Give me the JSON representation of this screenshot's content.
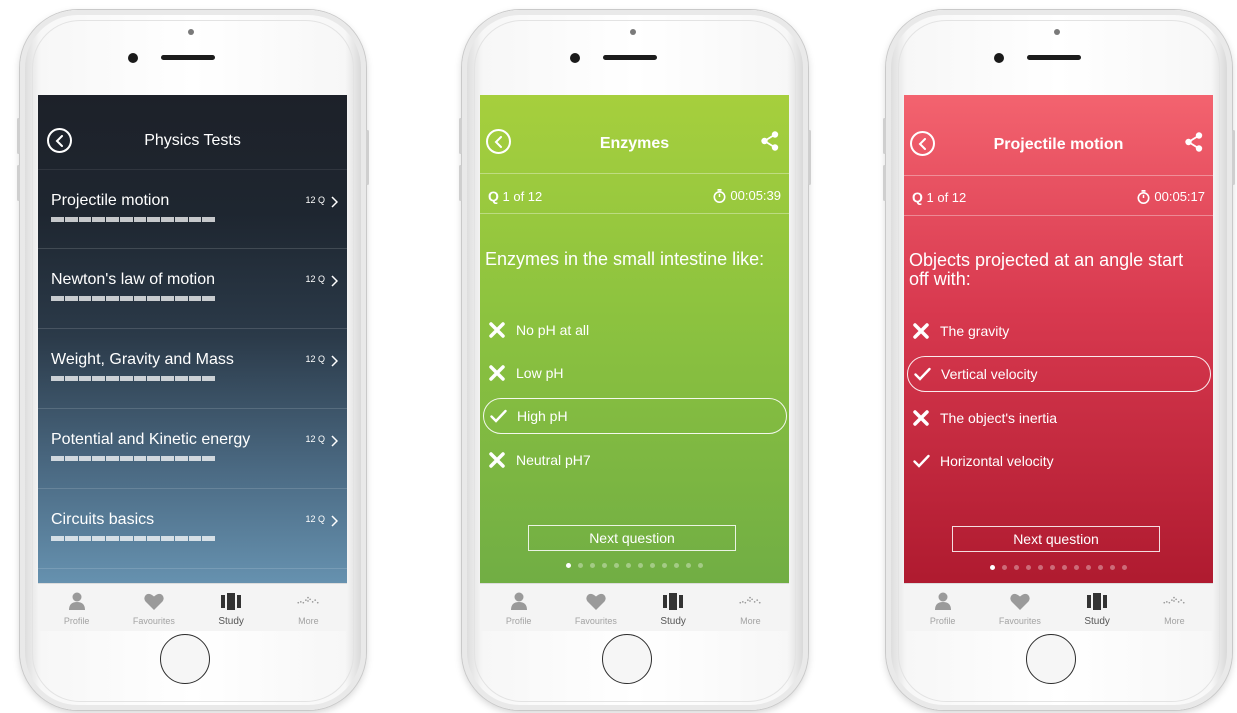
{
  "tabbar": {
    "items": [
      {
        "label": "Profile",
        "icon": "person-icon"
      },
      {
        "label": "Favourites",
        "icon": "heart-icon"
      },
      {
        "label": "Study",
        "icon": "cards-icon",
        "active": true
      },
      {
        "label": "More",
        "icon": "dots-wave-icon"
      }
    ]
  },
  "phone1": {
    "title": "Physics Tests",
    "tests": [
      {
        "name": "Projectile motion",
        "count": "12 Q"
      },
      {
        "name": "Newton's law of motion",
        "count": "12 Q"
      },
      {
        "name": "Weight, Gravity and Mass",
        "count": "12 Q"
      },
      {
        "name": "Potential and Kinetic energy",
        "count": "12 Q"
      },
      {
        "name": "Circuits basics",
        "count": "12 Q"
      }
    ],
    "background": "#1d2129"
  },
  "phone2": {
    "title": "Enzymes",
    "q_prefix": "Q",
    "q_progress": "1 of 12",
    "timer": "00:05:39",
    "question": "Enzymes in the small intestine like:",
    "answers": [
      {
        "text": "No pH at all",
        "mark": "cross-icon",
        "selected": false
      },
      {
        "text": "Low pH",
        "mark": "cross-icon",
        "selected": false
      },
      {
        "text": "High pH",
        "mark": "check-icon",
        "selected": true
      },
      {
        "text": "Neutral pH7",
        "mark": "cross-icon",
        "selected": false
      }
    ],
    "next_label": "Next question",
    "page_count": 12,
    "current_page": 1,
    "accent": "#8dc33f"
  },
  "phone3": {
    "title": "Projectile motion",
    "q_prefix": "Q",
    "q_progress": "1 of 12",
    "timer": "00:05:17",
    "question": "Objects projected at an angle start off with:",
    "answers": [
      {
        "text": "The gravity",
        "mark": "cross-icon",
        "selected": false
      },
      {
        "text": "Vertical velocity",
        "mark": "check-icon",
        "selected": true
      },
      {
        "text": "The object's inertia",
        "mark": "cross-icon",
        "selected": false
      },
      {
        "text": "Horizontal velocity",
        "mark": "check-icon",
        "selected": false
      }
    ],
    "next_label": "Next question",
    "page_count": 12,
    "current_page": 1,
    "accent": "#d8394f"
  }
}
